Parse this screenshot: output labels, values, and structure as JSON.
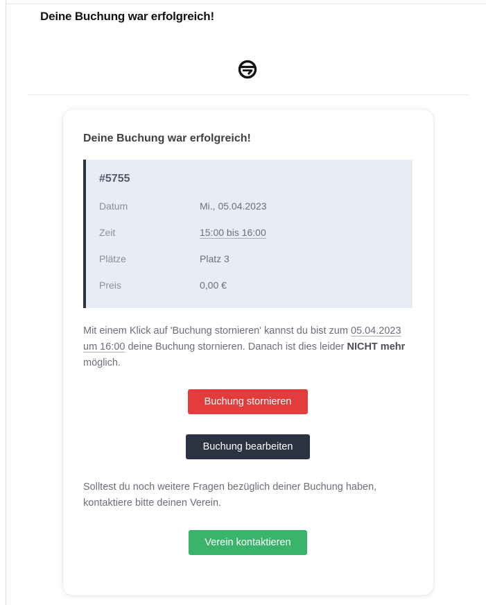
{
  "email": {
    "subject": "Deine Buchung war erfolgreich!"
  },
  "card": {
    "title": "Deine Buchung war erfolgreich!",
    "booking_id": "#5755",
    "details": [
      {
        "label": "Datum",
        "value": "Mi., 05.04.2023"
      },
      {
        "label": "Zeit",
        "value": "15:00 bis 16:00"
      },
      {
        "label": "Plätze",
        "value": "Platz 3"
      },
      {
        "label": "Preis",
        "value": "0,00 €"
      }
    ],
    "cancel_info": {
      "part1": "Mit einem Klick auf 'Buchung stornieren' kannst du bist zum ",
      "deadline": "05.04.2023 um 16:00",
      "part2": " deine Buchung stornieren. Danach ist dies leider ",
      "emphasis": "NICHT mehr",
      "part3": " möglich."
    },
    "cancel_button": "Buchung stornieren",
    "edit_button": "Buchung bearbeiten",
    "contact_info": "Solltest du noch weitere Fragen bezüglich deiner Buchung haben, kontaktiere bitte deinen Verein.",
    "contact_button": "Verein kontaktieren"
  },
  "colors": {
    "cancel": "#e23c3c",
    "edit": "#2b3242",
    "contact": "#3ab36b",
    "details_background": "#e8ecf5",
    "details_accent": "#2d3444"
  },
  "icons": {
    "logo": "club-logo-icon"
  }
}
